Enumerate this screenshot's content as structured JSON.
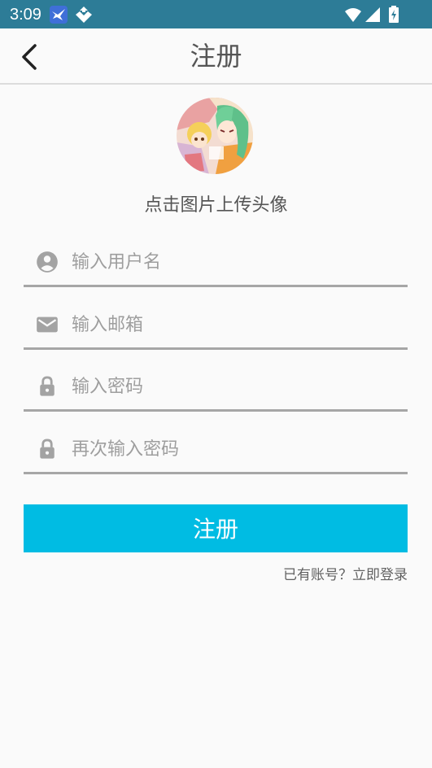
{
  "status_bar": {
    "time": "3:09",
    "notification_icons": [
      "bird-app-icon",
      "download-arrow-icon"
    ],
    "system_icons": [
      "wifi-icon",
      "cellular-signal-icon",
      "battery-charging-icon"
    ],
    "background_color": "#2d7c97"
  },
  "app_bar": {
    "back_icon": "chevron-left-icon",
    "title": "注册"
  },
  "avatar": {
    "hint": "点击图片上传头像"
  },
  "form": {
    "username": {
      "icon": "account-circle-icon",
      "value": "",
      "placeholder": "输入用户名"
    },
    "email": {
      "icon": "mail-icon",
      "value": "",
      "placeholder": "输入邮箱"
    },
    "password": {
      "icon": "lock-icon",
      "value": "",
      "placeholder": "输入密码"
    },
    "confirm_password": {
      "icon": "lock-icon",
      "value": "",
      "placeholder": "再次输入密码"
    }
  },
  "register_button": {
    "label": "注册",
    "color": "#00bce3"
  },
  "login_link": {
    "label": "已有账号？立即登录"
  }
}
